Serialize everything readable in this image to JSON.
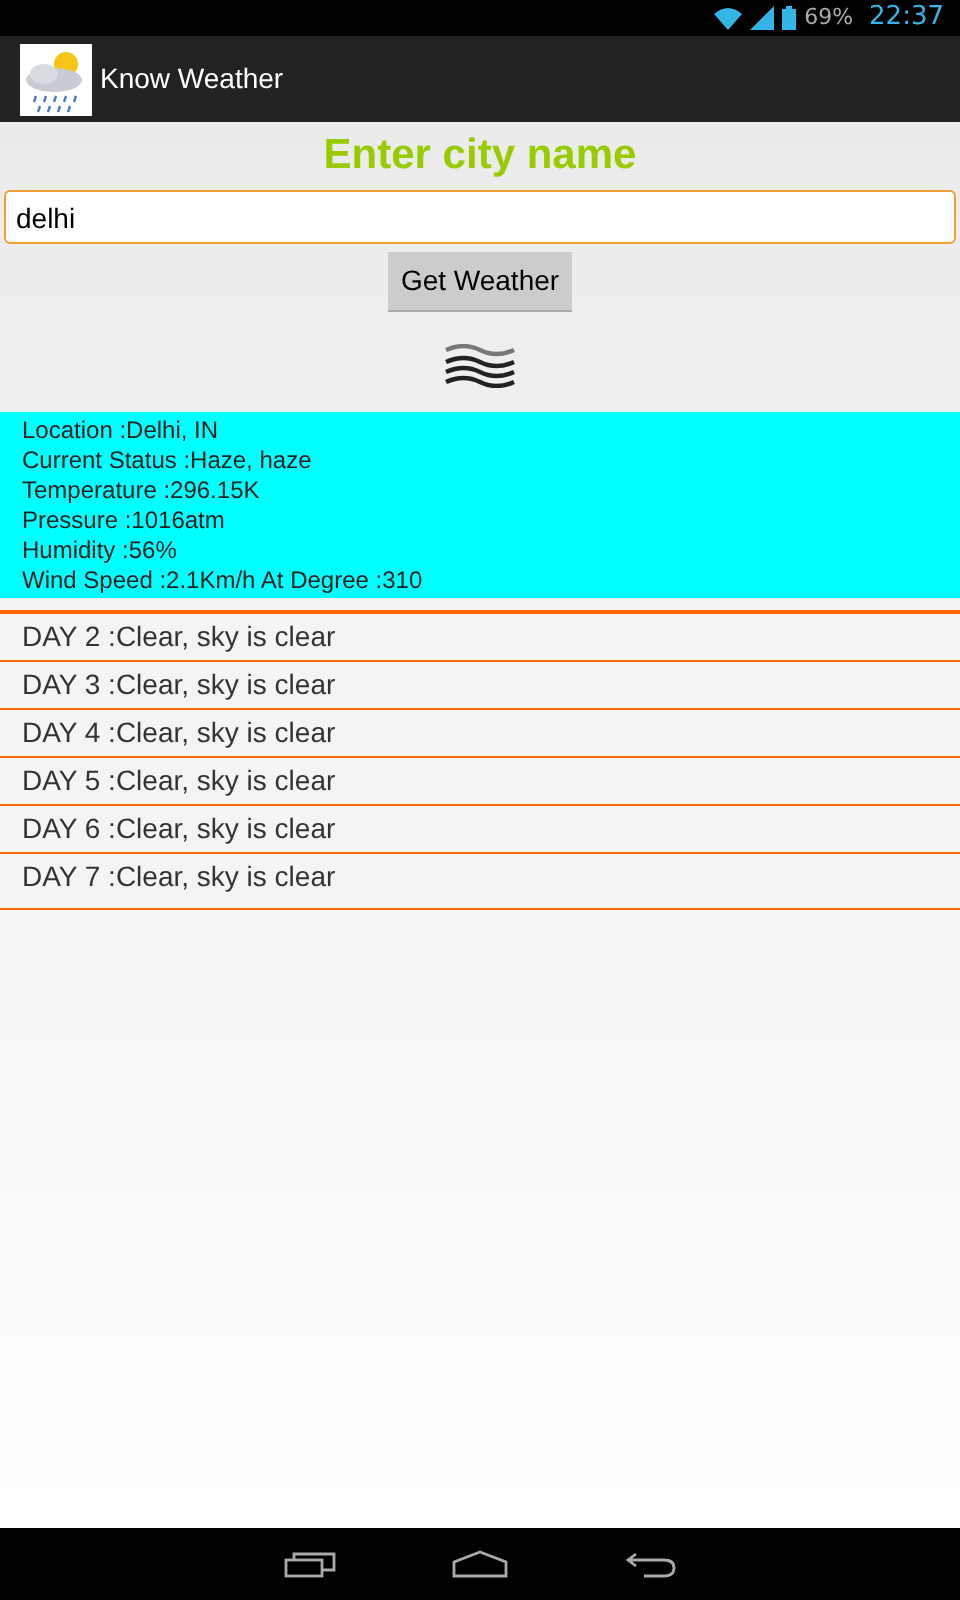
{
  "status_bar": {
    "battery": "69%",
    "time": "22:37"
  },
  "app_bar": {
    "title": "Know Weather"
  },
  "form": {
    "heading": "Enter city name",
    "city_field": {
      "value": "delhi"
    },
    "button": "Get Weather"
  },
  "current": [
    "Location :Delhi, IN",
    "Current Status :Haze, haze",
    "Temperature :296.15K",
    "Pressure :1016atm",
    "Humidity :56%",
    "Wind Speed :2.1Km/h At Degree :310"
  ],
  "forecast": [
    "DAY 2 :Clear, sky is clear",
    "DAY 3 :Clear, sky is clear",
    "DAY 4 :Clear, sky is clear",
    "DAY 5 :Clear, sky is clear",
    "DAY 6 :Clear, sky is clear",
    "DAY 7 :Clear, sky is clear"
  ]
}
